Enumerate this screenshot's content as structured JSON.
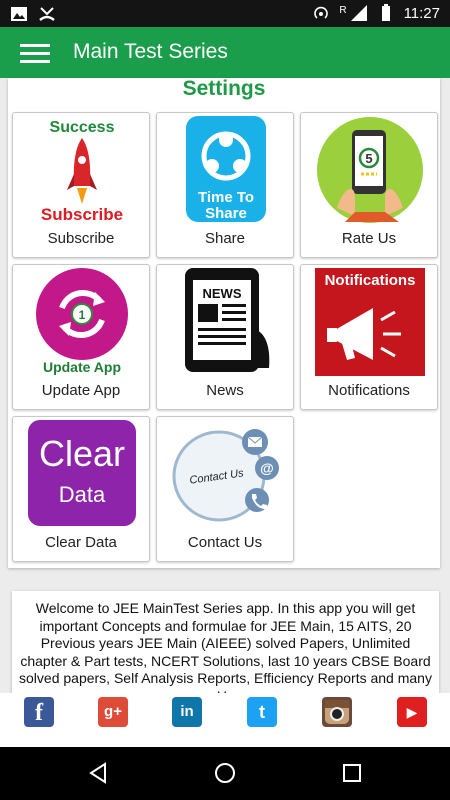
{
  "status_bar": {
    "time": "11:27",
    "carrier_label": "R"
  },
  "app_bar": {
    "title": "Main Test Series"
  },
  "main": {
    "heading": "Settings",
    "tiles": [
      {
        "label": "Subscribe",
        "icon": "rocket-icon",
        "text_top": "Success",
        "text_bottom": "Subscribe"
      },
      {
        "label": "Share",
        "icon": "share-icon",
        "text_line1": "Time To",
        "text_line2": "Share"
      },
      {
        "label": "Rate Us",
        "icon": "rate-us-icon",
        "number": "5"
      },
      {
        "label": "Update App",
        "icon": "update-icon",
        "number": "1",
        "text_bottom": "Update App"
      },
      {
        "label": "News",
        "icon": "news-icon",
        "text_top": "NEWS"
      },
      {
        "label": "Notifications",
        "icon": "megaphone-icon",
        "text_top": "Notifications"
      },
      {
        "label": "Clear Data",
        "icon": "clear-data-icon",
        "text_line1": "Clear",
        "text_line2": "Data"
      },
      {
        "label": "Contact Us",
        "icon": "contact-us-icon",
        "text_center": "Contact Us"
      }
    ]
  },
  "info": {
    "text": "Welcome to JEE MainTest Series app. In this app you will get important Concepts and formulae for JEE Main, 15 AITS, 20 Previous years JEE Main (AIEEE) solved Papers, Unlimited chapter & Part tests, NCERT Solutions, last 10 years CBSE Board solved papers, Self Analysis Reports, Efficiency Reports and many more. Here you"
  },
  "social": [
    {
      "name": "facebook",
      "glyph": "f",
      "color": "#3b5998"
    },
    {
      "name": "google-plus",
      "glyph": "g+",
      "color": "#dd4b39"
    },
    {
      "name": "linkedin",
      "glyph": "in",
      "color": "#0e76a8"
    },
    {
      "name": "twitter",
      "glyph": "t",
      "color": "#1da1f2"
    },
    {
      "name": "instagram",
      "glyph": "",
      "color": "#6b4a3a"
    },
    {
      "name": "youtube",
      "glyph": "▶",
      "color": "#e02020"
    }
  ],
  "colors": {
    "primary": "#1b9e4b",
    "heading": "#1e9a46"
  }
}
